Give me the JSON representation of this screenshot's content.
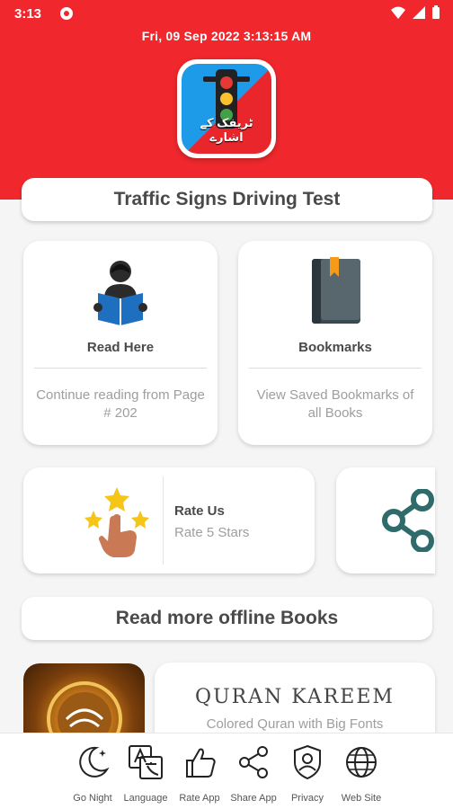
{
  "status_bar": {
    "time": "3:13"
  },
  "header": {
    "datetime": "Fri, 09  Sep  2022  3:13:15 AM",
    "logo_text": "ٹریفک کے اشارے"
  },
  "title_card": {
    "title": "Traffic Signs Driving Test"
  },
  "cards": {
    "read_here": {
      "label": "Read Here",
      "subtitle": "Continue reading from Page # 202"
    },
    "bookmarks": {
      "label": "Bookmarks",
      "subtitle": "View Saved Bookmarks of all Books"
    },
    "rate_us": {
      "title": "Rate Us",
      "subtitle": "Rate 5 Stars"
    }
  },
  "section": {
    "title": "Read more offline Books"
  },
  "book": {
    "title": "QURAN KAREEM",
    "subtitle": "Colored Quran with Big Fonts"
  },
  "bottom_nav": [
    {
      "label": "Go Night",
      "icon": "moon-icon"
    },
    {
      "label": "Language",
      "icon": "translate-icon"
    },
    {
      "label": "Rate App",
      "icon": "thumbs-up-icon"
    },
    {
      "label": "Share App",
      "icon": "share-icon"
    },
    {
      "label": "Privacy",
      "icon": "shield-user-icon"
    },
    {
      "label": "Web Site",
      "icon": "globe-icon"
    }
  ],
  "colors": {
    "header": "#f0282d",
    "share_teal": "#2e6b6a",
    "star": "#f5c518"
  }
}
